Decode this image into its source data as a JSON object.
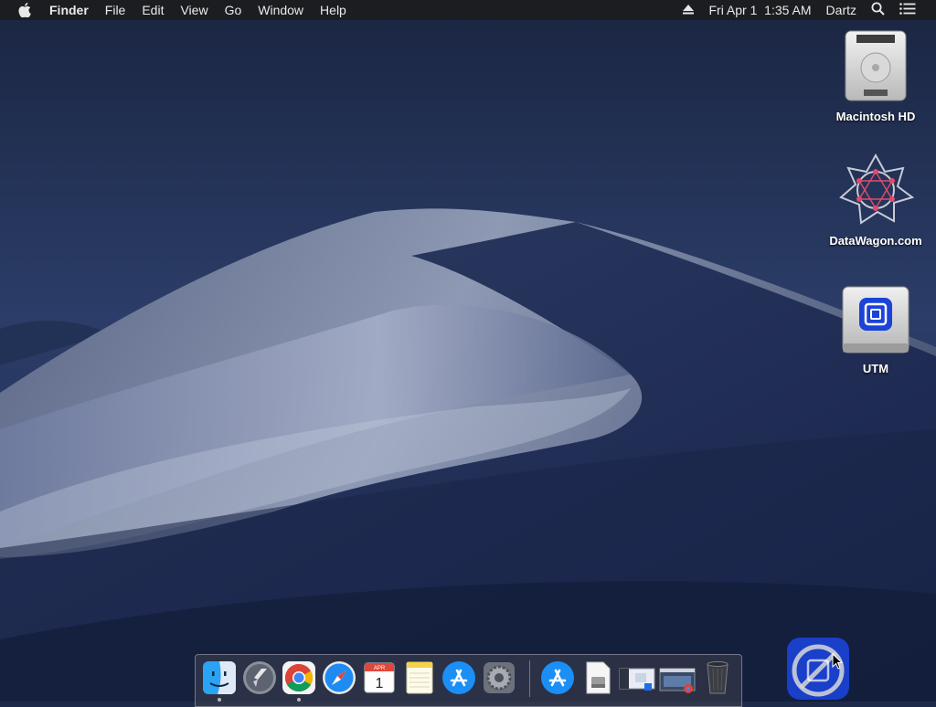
{
  "menubar": {
    "app_name": "Finder",
    "menus": [
      "File",
      "Edit",
      "View",
      "Go",
      "Window",
      "Help"
    ],
    "clock": "Fri Apr 1  1:35 AM",
    "user": "Dartz",
    "icons": [
      "apple-icon",
      "eject-icon",
      "spotlight-icon",
      "notification-center-icon"
    ]
  },
  "desktop": {
    "icons": [
      {
        "label": "Macintosh HD",
        "icon": "hard-drive-icon"
      },
      {
        "label": "DataWagon.com",
        "icon": "datawagon-icon"
      },
      {
        "label": "UTM",
        "icon": "utm-disk-icon"
      }
    ]
  },
  "dock": {
    "apps": [
      "Finder",
      "Launchpad",
      "Google Chrome",
      "Safari",
      "Calendar",
      "Notes",
      "App Store",
      "System Preferences"
    ],
    "running": [
      "Finder",
      "Google Chrome"
    ],
    "calendar": {
      "month": "APR",
      "day": "1"
    },
    "others": [
      "App Store installer",
      "Disk image",
      "Screenshot",
      "Screenshot",
      "Trash"
    ]
  },
  "colors": {
    "menubar": "#1c1c1e",
    "sky": "#1f2f55",
    "accent": "#1b6fe8"
  }
}
